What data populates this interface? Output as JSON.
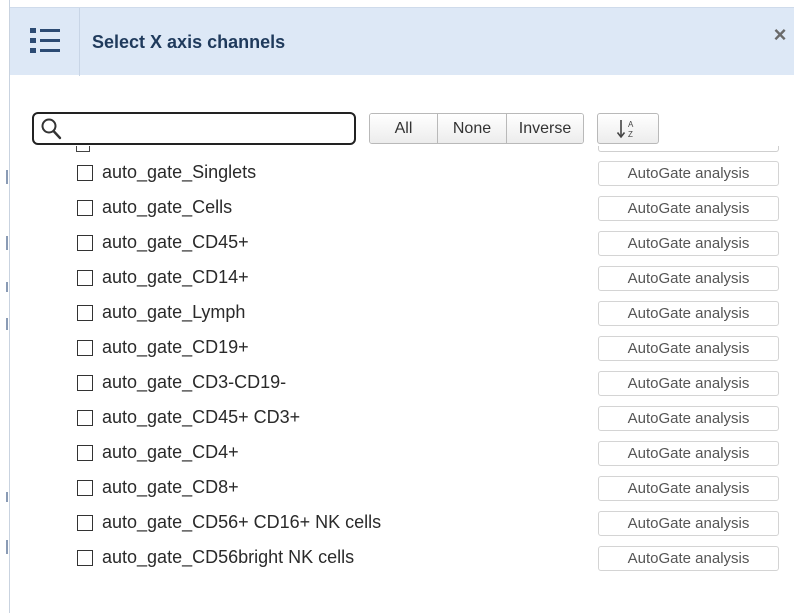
{
  "dialog": {
    "title": "Select X axis channels",
    "close_label": "×"
  },
  "search": {
    "value": "",
    "placeholder": ""
  },
  "toolbar": {
    "all_label": "All",
    "none_label": "None",
    "inverse_label": "Inverse",
    "sort_icon": "sort-alpha-icon"
  },
  "channels": [
    {
      "label": "auto_gate_Singlets",
      "tag": "AutoGate analysis",
      "checked": false
    },
    {
      "label": "auto_gate_Cells",
      "tag": "AutoGate analysis",
      "checked": false
    },
    {
      "label": "auto_gate_CD45+",
      "tag": "AutoGate analysis",
      "checked": false
    },
    {
      "label": "auto_gate_CD14+",
      "tag": "AutoGate analysis",
      "checked": false
    },
    {
      "label": "auto_gate_Lymph",
      "tag": "AutoGate analysis",
      "checked": false
    },
    {
      "label": "auto_gate_CD19+",
      "tag": "AutoGate analysis",
      "checked": false
    },
    {
      "label": "auto_gate_CD3-CD19-",
      "tag": "AutoGate analysis",
      "checked": false
    },
    {
      "label": "auto_gate_CD45+ CD3+",
      "tag": "AutoGate analysis",
      "checked": false
    },
    {
      "label": "auto_gate_CD4+",
      "tag": "AutoGate analysis",
      "checked": false
    },
    {
      "label": "auto_gate_CD8+",
      "tag": "AutoGate analysis",
      "checked": false
    },
    {
      "label": "auto_gate_CD56+ CD16+ NK cells",
      "tag": "AutoGate analysis",
      "checked": false
    },
    {
      "label": "auto_gate_CD56bright NK cells",
      "tag": "AutoGate analysis",
      "checked": false
    }
  ],
  "colors": {
    "header_bg": "#dde8f6",
    "title_color": "#1f3a5c",
    "icon_color": "#2b4a73"
  }
}
